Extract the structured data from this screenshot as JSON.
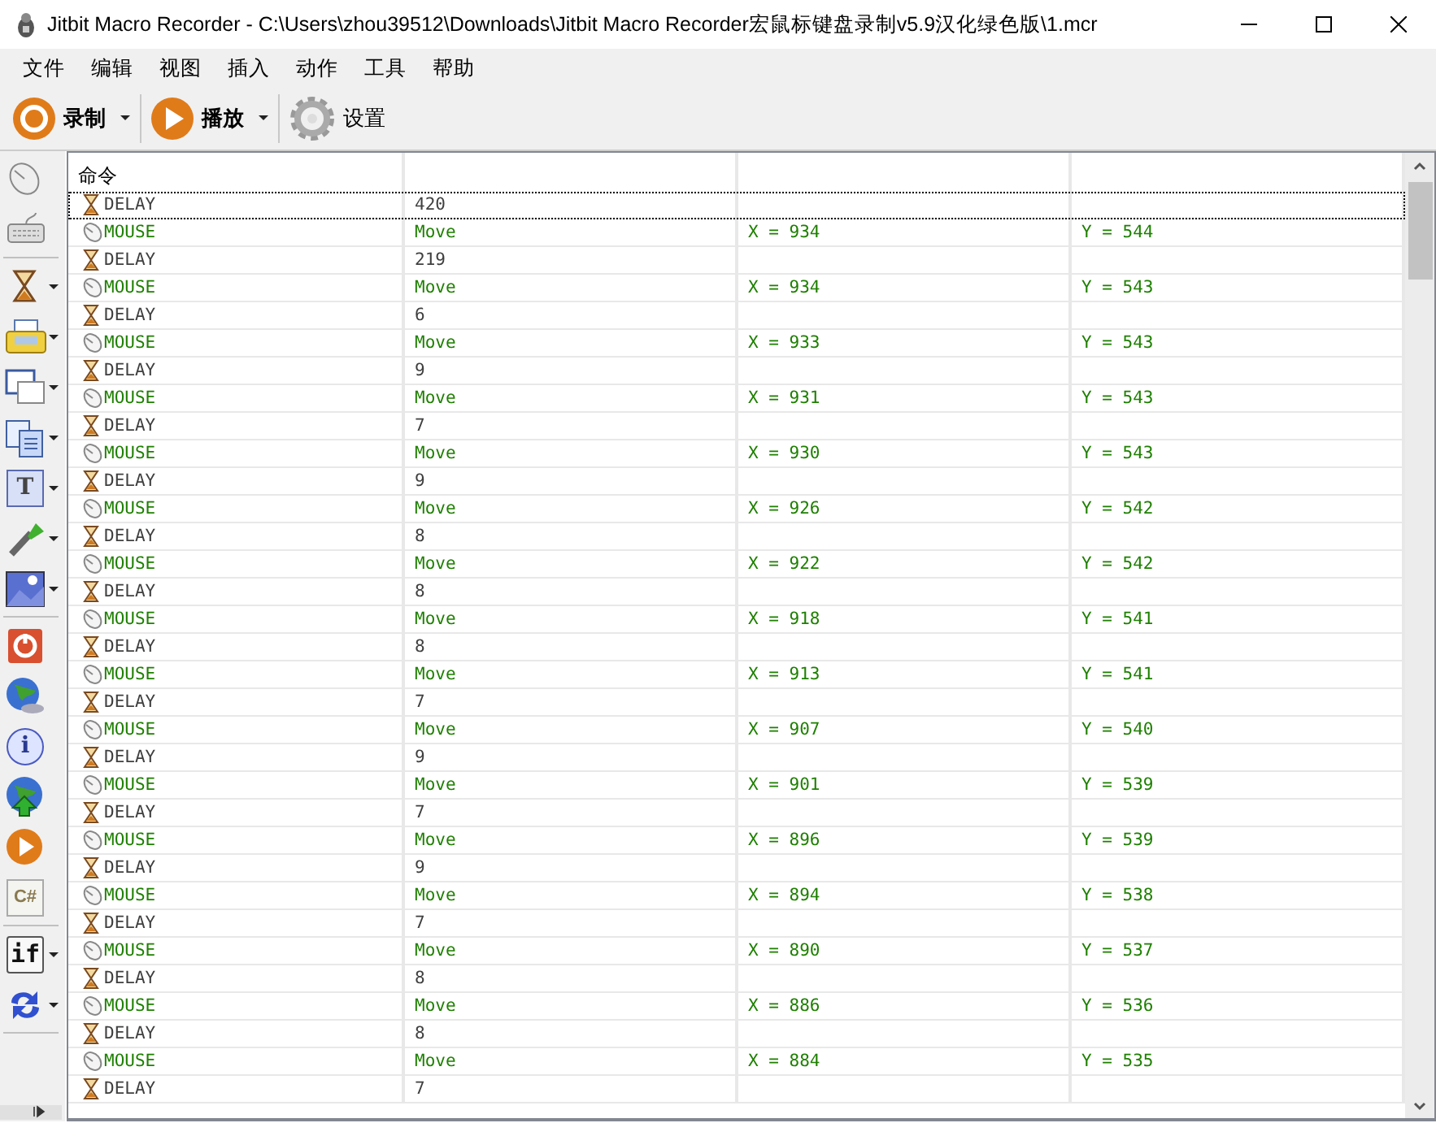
{
  "window": {
    "title": "Jitbit Macro Recorder - C:\\Users\\zhou39512\\Downloads\\Jitbit Macro Recorder宏鼠标键盘录制v5.9汉化绿色版\\1.mcr"
  },
  "menu": [
    "文件",
    "编辑",
    "视图",
    "插入",
    "动作",
    "工具",
    "帮助"
  ],
  "toolbar": [
    {
      "kind": "record",
      "label": "录制",
      "dropdown": true,
      "bold": true
    },
    {
      "kind": "play",
      "label": "播放",
      "dropdown": true,
      "bold": true
    },
    {
      "kind": "settings",
      "label": "设置",
      "dropdown": false,
      "bold": false
    }
  ],
  "sidebar": [
    {
      "kind": "mouse",
      "dropdown": false
    },
    {
      "kind": "keyboard",
      "dropdown": false
    },
    {
      "kind": "separator"
    },
    {
      "kind": "hourglass",
      "dropdown": true
    },
    {
      "kind": "printer",
      "dropdown": true
    },
    {
      "kind": "windows",
      "dropdown": true
    },
    {
      "kind": "copy",
      "dropdown": true
    },
    {
      "kind": "text",
      "dropdown": true,
      "label": "T"
    },
    {
      "kind": "eyedropper",
      "dropdown": true
    },
    {
      "kind": "image",
      "dropdown": true
    },
    {
      "kind": "separator"
    },
    {
      "kind": "stop",
      "dropdown": false
    },
    {
      "kind": "globe",
      "dropdown": false
    },
    {
      "kind": "info",
      "dropdown": false,
      "label": "i"
    },
    {
      "kind": "upload",
      "dropdown": false
    },
    {
      "kind": "play",
      "dropdown": false
    },
    {
      "kind": "code",
      "dropdown": false,
      "label": "C#"
    },
    {
      "kind": "separator"
    },
    {
      "kind": "if",
      "dropdown": true,
      "label": "if"
    },
    {
      "kind": "loop",
      "dropdown": true
    },
    {
      "kind": "separator"
    }
  ],
  "table": {
    "columns": [
      "命令"
    ],
    "rows": [
      {
        "kind": "delay",
        "command": "DELAY",
        "col2": "420",
        "focused": true
      },
      {
        "kind": "mouse",
        "command": "MOUSE",
        "col2": "Move",
        "col3": "X = 934",
        "col4": "Y = 544",
        "focused": false
      },
      {
        "kind": "delay",
        "command": "DELAY",
        "col2": "219",
        "focused": false
      },
      {
        "kind": "mouse",
        "command": "MOUSE",
        "col2": "Move",
        "col3": "X = 934",
        "col4": "Y = 543",
        "focused": false
      },
      {
        "kind": "delay",
        "command": "DELAY",
        "col2": "6",
        "focused": false
      },
      {
        "kind": "mouse",
        "command": "MOUSE",
        "col2": "Move",
        "col3": "X = 933",
        "col4": "Y = 543",
        "focused": false
      },
      {
        "kind": "delay",
        "command": "DELAY",
        "col2": "9",
        "focused": false
      },
      {
        "kind": "mouse",
        "command": "MOUSE",
        "col2": "Move",
        "col3": "X = 931",
        "col4": "Y = 543",
        "focused": false
      },
      {
        "kind": "delay",
        "command": "DELAY",
        "col2": "7",
        "focused": false
      },
      {
        "kind": "mouse",
        "command": "MOUSE",
        "col2": "Move",
        "col3": "X = 930",
        "col4": "Y = 543",
        "focused": false
      },
      {
        "kind": "delay",
        "command": "DELAY",
        "col2": "9",
        "focused": false
      },
      {
        "kind": "mouse",
        "command": "MOUSE",
        "col2": "Move",
        "col3": "X = 926",
        "col4": "Y = 542",
        "focused": false
      },
      {
        "kind": "delay",
        "command": "DELAY",
        "col2": "8",
        "focused": false
      },
      {
        "kind": "mouse",
        "command": "MOUSE",
        "col2": "Move",
        "col3": "X = 922",
        "col4": "Y = 542",
        "focused": false
      },
      {
        "kind": "delay",
        "command": "DELAY",
        "col2": "8",
        "focused": false
      },
      {
        "kind": "mouse",
        "command": "MOUSE",
        "col2": "Move",
        "col3": "X = 918",
        "col4": "Y = 541",
        "focused": false
      },
      {
        "kind": "delay",
        "command": "DELAY",
        "col2": "8",
        "focused": false
      },
      {
        "kind": "mouse",
        "command": "MOUSE",
        "col2": "Move",
        "col3": "X = 913",
        "col4": "Y = 541",
        "focused": false
      },
      {
        "kind": "delay",
        "command": "DELAY",
        "col2": "7",
        "focused": false
      },
      {
        "kind": "mouse",
        "command": "MOUSE",
        "col2": "Move",
        "col3": "X = 907",
        "col4": "Y = 540",
        "focused": false
      },
      {
        "kind": "delay",
        "command": "DELAY",
        "col2": "9",
        "focused": false
      },
      {
        "kind": "mouse",
        "command": "MOUSE",
        "col2": "Move",
        "col3": "X = 901",
        "col4": "Y = 539",
        "focused": false
      },
      {
        "kind": "delay",
        "command": "DELAY",
        "col2": "7",
        "focused": false
      },
      {
        "kind": "mouse",
        "command": "MOUSE",
        "col2": "Move",
        "col3": "X = 896",
        "col4": "Y = 539",
        "focused": false
      },
      {
        "kind": "delay",
        "command": "DELAY",
        "col2": "9",
        "focused": false
      },
      {
        "kind": "mouse",
        "command": "MOUSE",
        "col2": "Move",
        "col3": "X = 894",
        "col4": "Y = 538",
        "focused": false
      },
      {
        "kind": "delay",
        "command": "DELAY",
        "col2": "7",
        "focused": false
      },
      {
        "kind": "mouse",
        "command": "MOUSE",
        "col2": "Move",
        "col3": "X = 890",
        "col4": "Y = 537",
        "focused": false
      },
      {
        "kind": "delay",
        "command": "DELAY",
        "col2": "8",
        "focused": false
      },
      {
        "kind": "mouse",
        "command": "MOUSE",
        "col2": "Move",
        "col3": "X = 886",
        "col4": "Y = 536",
        "focused": false
      },
      {
        "kind": "delay",
        "command": "DELAY",
        "col2": "8",
        "focused": false
      },
      {
        "kind": "mouse",
        "command": "MOUSE",
        "col2": "Move",
        "col3": "X = 884",
        "col4": "Y = 535",
        "focused": false
      },
      {
        "kind": "delay",
        "command": "DELAY",
        "col2": "7",
        "focused": false
      }
    ]
  }
}
